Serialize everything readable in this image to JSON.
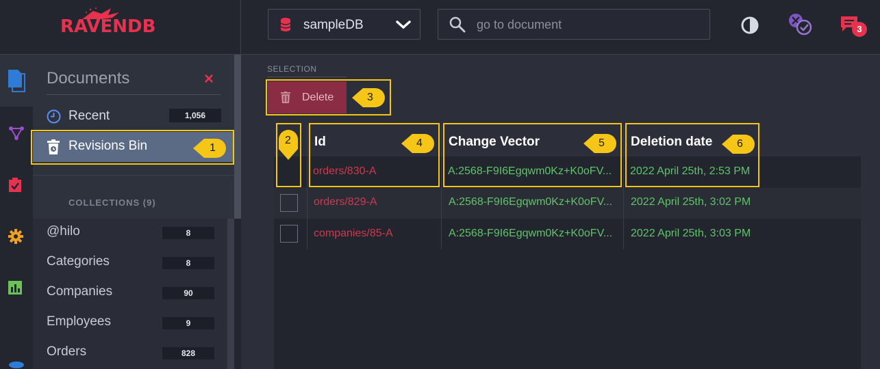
{
  "header": {
    "logo_text": "RAVENDB",
    "database": "sampleDB",
    "search_placeholder": "go to document",
    "notifications_count": "3"
  },
  "documents_panel": {
    "title": "Documents",
    "items": [
      {
        "label": "Recent",
        "count": "1,056"
      },
      {
        "label": "Revisions Bin"
      }
    ],
    "collections_title": "COLLECTIONS (9)",
    "collections": [
      {
        "label": "@hilo",
        "count": "8"
      },
      {
        "label": "Categories",
        "count": "8"
      },
      {
        "label": "Companies",
        "count": "90"
      },
      {
        "label": "Employees",
        "count": "9"
      },
      {
        "label": "Orders",
        "count": "828"
      }
    ]
  },
  "main": {
    "selection_label": "SELECTION",
    "delete_label": "Delete",
    "columns": [
      "Id",
      "Change Vector",
      "Deletion date"
    ],
    "rows": [
      {
        "id": "orders/830-A",
        "change_vector": "A:2568-F9I6Egqwm0Kz+K0oFV...",
        "deletion_date": "2022 April 25th, 2:53 PM"
      },
      {
        "id": "orders/829-A",
        "change_vector": "A:2568-F9I6Egqwm0Kz+K0oFV...",
        "deletion_date": "2022 April 25th, 3:02 PM"
      },
      {
        "id": "companies/85-A",
        "change_vector": "A:2568-F9I6Egqwm0Kz+K0oFV...",
        "deletion_date": "2022 April 25th, 3:03 PM"
      }
    ]
  },
  "callouts": [
    "1",
    "2",
    "3",
    "4",
    "5",
    "6"
  ],
  "colors": {
    "brand": "#e5324e",
    "highlight": "#f5c518",
    "selected_item": "#5b6b86",
    "delete_button": "#8b2c45",
    "id_text": "#d0384f",
    "green_text": "#5fc46a"
  }
}
